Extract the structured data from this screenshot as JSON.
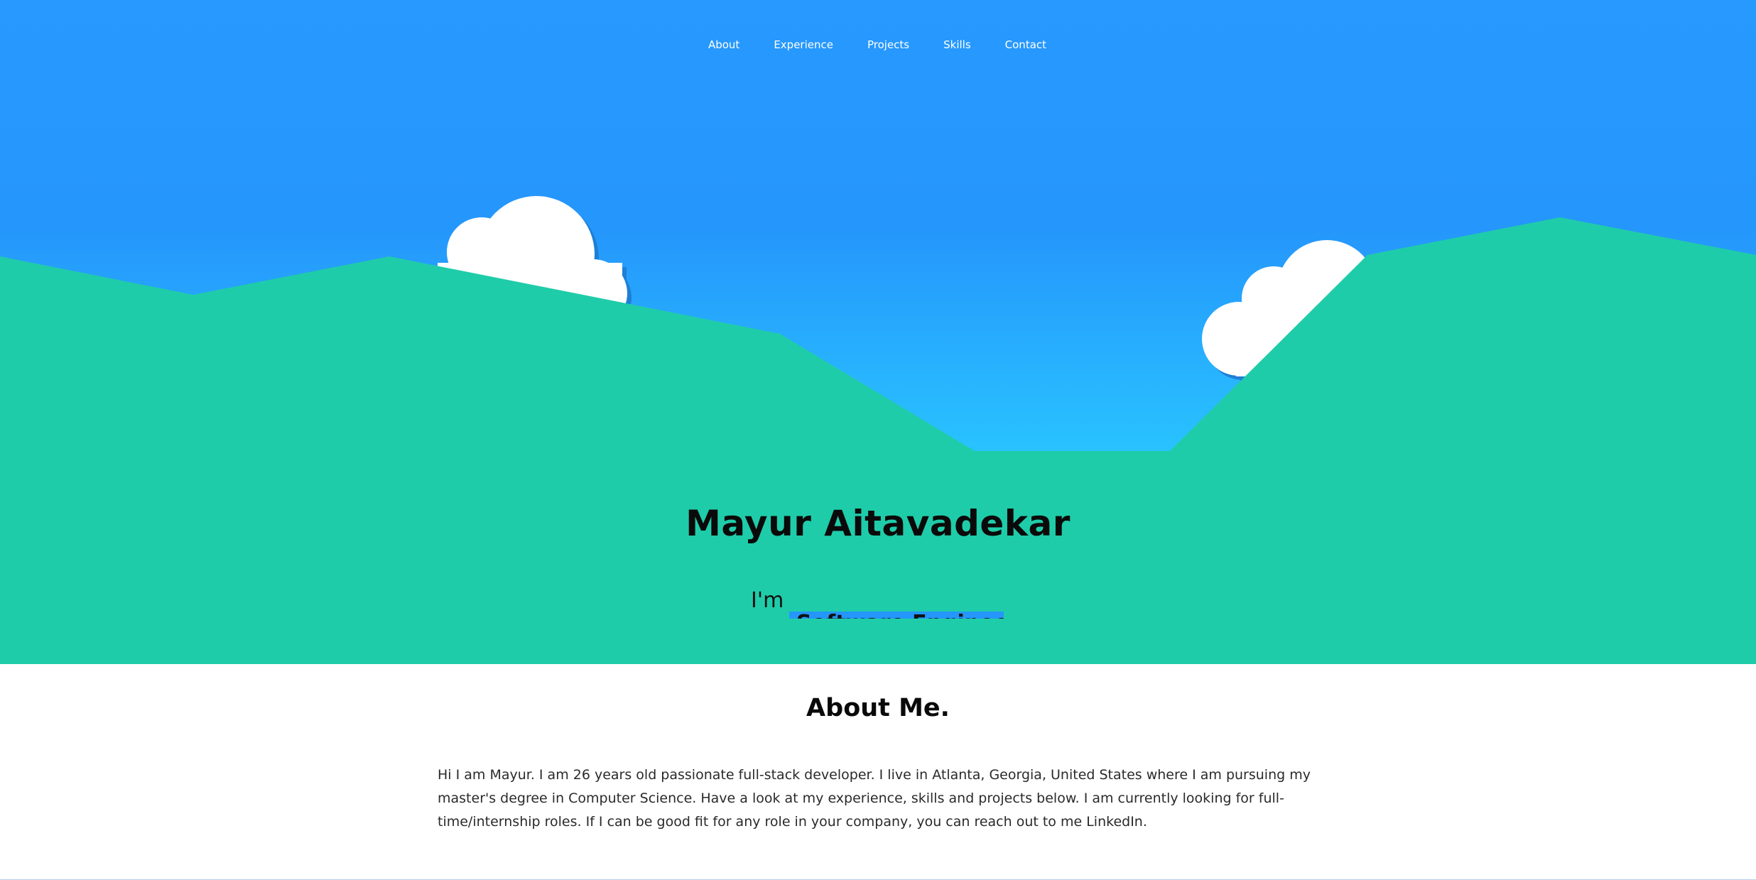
{
  "nav": {
    "items": [
      "About",
      "Experience",
      "Projects",
      "Skills",
      "Contact"
    ]
  },
  "hero": {
    "name": "Mayur Aitavadekar",
    "intro": "I'm",
    "typed_text": "Software Engineer"
  },
  "about": {
    "title": "About Me.",
    "text": "Hi I am Mayur. I am 26 years old passionate full-stack developer. I live in Atlanta, Georgia, United States where I am pursuing my master's degree in Computer Science. Have a look at my experience, skills and projects below. I am currently looking for full-time/internship roles. If I can be good fit for any role in your company, you can reach out to me LinkedIn."
  },
  "colors": {
    "sky_top": "#2799ff",
    "sky_bottom": "#29c3ff",
    "hills": "#1fcca9",
    "cloud": "#ffffff",
    "cloud_shadow": "#1e7fd6",
    "highlight": "#2596fc"
  }
}
